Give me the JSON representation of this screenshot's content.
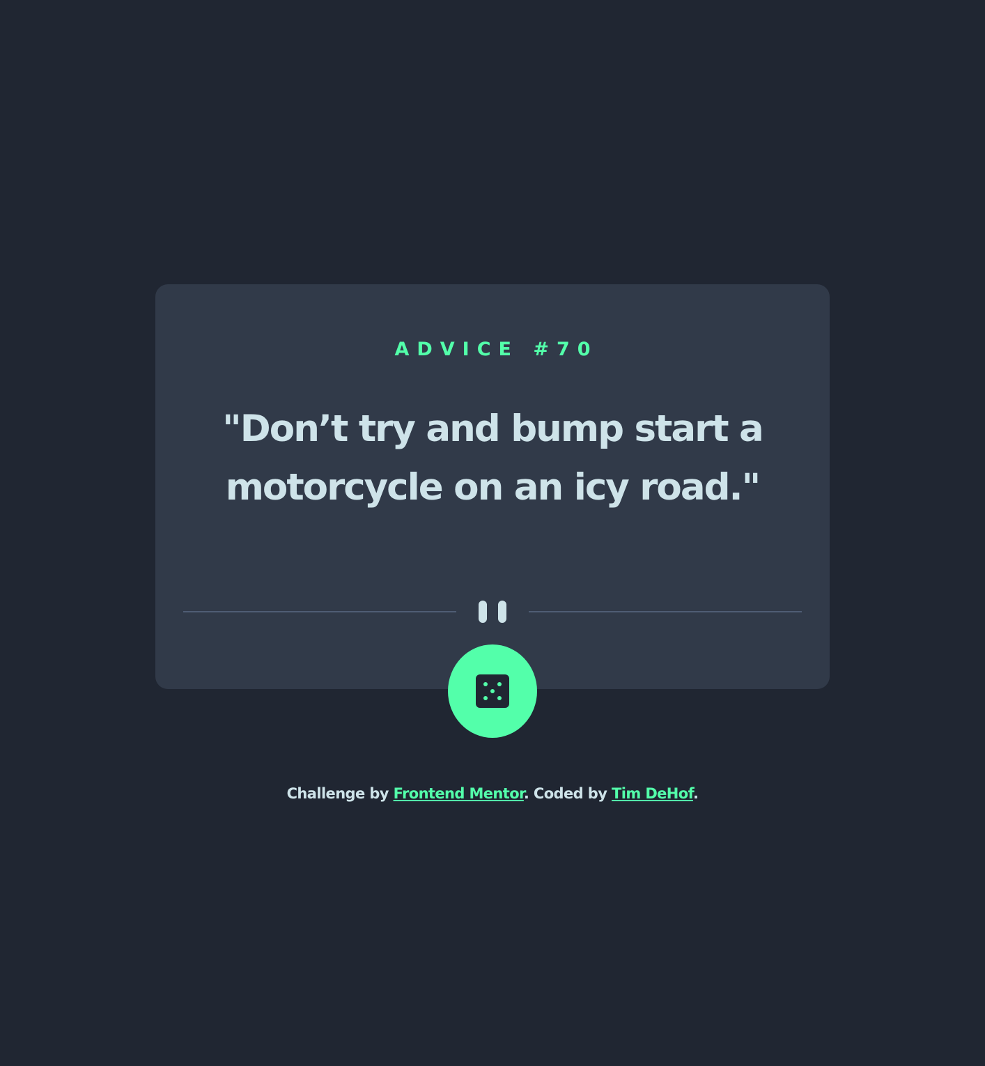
{
  "advice": {
    "heading": "ADVICE #70",
    "text": "\"Don’t try and bump start a motorcycle on an icy road.\""
  },
  "divider": {
    "icon": "pause-icon"
  },
  "generate_button": {
    "icon": "dice-icon"
  },
  "footer": {
    "prefix": "Challenge by ",
    "challenge_link": "Frontend Mentor",
    "middle": ". Coded by ",
    "author_link": "Tim DeHof",
    "suffix": "."
  },
  "colors": {
    "background": "#202632",
    "card": "#313A49",
    "accent": "#53FFAA",
    "text": "#CEE3E9",
    "divider": "#4F5D74"
  }
}
